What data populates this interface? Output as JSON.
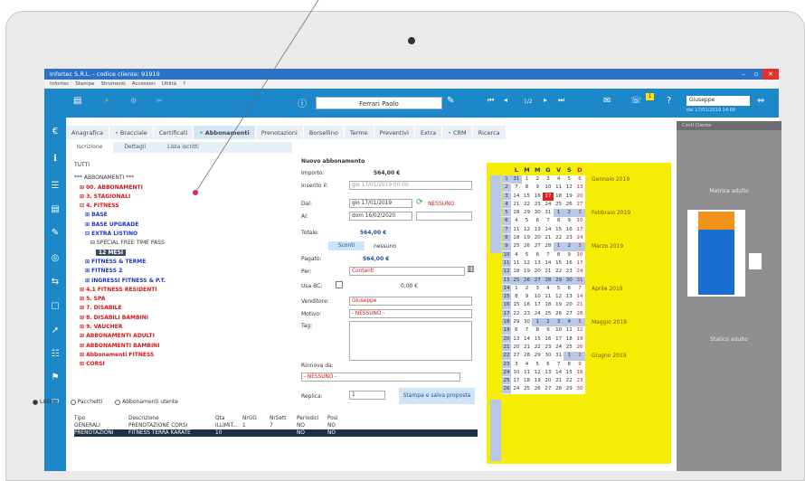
{
  "window": {
    "title": "Infortec S.R.L. - codice cliente: 91919",
    "controls": [
      "–",
      "▫",
      "✕"
    ]
  },
  "menu": [
    "Infortec",
    "Stampe",
    "Strumenti",
    "Accessori",
    "Utilità",
    "?"
  ],
  "toolbar": {
    "info_icon": "ⓘ",
    "patient_name": "Ferrari Paolo",
    "pager": "1/2",
    "badge_count": "1",
    "help": "?",
    "operator": "Giuseppe",
    "operator_sub": "dal 17/01/2019 14:00"
  },
  "sidebar_icons": [
    "€",
    "ℹ",
    "☰",
    "▤",
    "✎",
    "◎",
    "⇆",
    "☐",
    "➚",
    "☷",
    "⚑",
    "▭"
  ],
  "tabs": [
    {
      "label": "Anagrafica",
      "dot": false
    },
    {
      "label": "Bracciale",
      "dot": true
    },
    {
      "label": "Certificati",
      "dot": false
    },
    {
      "label": "Abbonamenti",
      "dot": true,
      "active": true
    },
    {
      "label": "Prenotazioni",
      "dot": false
    },
    {
      "label": "Borsellino",
      "dot": false
    },
    {
      "label": "Terme",
      "dot": false
    },
    {
      "label": "Preventivi",
      "dot": false
    },
    {
      "label": "Extra",
      "dot": false
    },
    {
      "label": "CRM",
      "dot": true
    },
    {
      "label": "Ricerca",
      "dot": false
    }
  ],
  "subtabs": [
    "Iscrizione",
    "Dettagli",
    "Lista iscritti"
  ],
  "tree": {
    "header": "TUTTI",
    "items": [
      {
        "text": "*** ABBONAMENTI ***",
        "cls": "dark",
        "indent": 0
      },
      {
        "text": "⊞ 00. ABBONAMENTI",
        "cls": "red",
        "indent": 1
      },
      {
        "text": "⊞ 3. STAGIONALI",
        "cls": "red",
        "indent": 1
      },
      {
        "text": "⊟ 4. FITNESS",
        "cls": "red",
        "indent": 1
      },
      {
        "text": "⊞ BASE",
        "cls": "blue",
        "indent": 2
      },
      {
        "text": "⊞ BASE UPGRADE",
        "cls": "blue",
        "indent": 2
      },
      {
        "text": "⊟ EXTRA LISTINO",
        "cls": "blue",
        "indent": 2
      },
      {
        "text": "⊟ SPECIAL FREE TIME PASS",
        "cls": "dark",
        "indent": 3
      },
      {
        "text": "12 MESI",
        "cls": "sel",
        "indent": 4
      },
      {
        "text": "⊞ FITNESS & TERME",
        "cls": "blue",
        "indent": 2
      },
      {
        "text": "⊞ FITNESS 2",
        "cls": "blue",
        "indent": 2
      },
      {
        "text": "⊞ INGRESSI FITNESS & P.T.",
        "cls": "blue",
        "indent": 2
      },
      {
        "text": "⊞ 4.1 FITNESS RESIDENTI",
        "cls": "red",
        "indent": 1
      },
      {
        "text": "⊞ 5. SPA",
        "cls": "red",
        "indent": 1
      },
      {
        "text": "⊞ 7. DISABILE",
        "cls": "red",
        "indent": 1
      },
      {
        "text": "⊞ 8. DISABILI BAMBINI",
        "cls": "red",
        "indent": 1
      },
      {
        "text": "⊞ 9. VAUCHER",
        "cls": "red",
        "indent": 1
      },
      {
        "text": "⊞ ABBONAMENTI ADULTI",
        "cls": "red",
        "indent": 1
      },
      {
        "text": "⊞ ABBONAMENTI BAMBINI",
        "cls": "red",
        "indent": 1
      },
      {
        "text": "⊞ Abbonamenti FITNESS",
        "cls": "red",
        "indent": 1
      },
      {
        "text": "⊞ CORSI",
        "cls": "red",
        "indent": 1
      }
    ]
  },
  "radios": [
    {
      "label": "Listino",
      "on": true
    },
    {
      "label": "Pacchetti",
      "on": false
    },
    {
      "label": "Abbonamenti utente",
      "on": false
    }
  ],
  "grid": {
    "headers": [
      "Tipo",
      "Descrizione",
      "Qta",
      "NrGG",
      "NrSett",
      "Periodici",
      "Posi"
    ],
    "rows": [
      [
        "GENERALI",
        "PRENOTAZIONE CORSI",
        "ILLIMIT...",
        "1",
        "7",
        "NO",
        "NO"
      ],
      [
        "PRENOTAZIONI",
        "FITNESS TERRA KARATE",
        "10",
        "",
        "",
        "NO",
        "NO"
      ]
    ]
  },
  "form": {
    "title": "Nuovo abbonamento",
    "importo_label": "Importo:",
    "importo": "564,00 €",
    "inizio_label": "Inserito il:",
    "inizio_value": "gio 17/01/2019 00:00",
    "dal_label": "Dal:",
    "dal_value": "gio 17/01/2019",
    "nessuno": "NESSUNO",
    "al_label": "Al:",
    "al_value": "dom 16/02/2020",
    "totale_label": "Totale:",
    "totale": "564,00 €",
    "sconti_btn": "Sconti",
    "sconti_value": "nessuno",
    "pagato_label": "Pagato:",
    "pagato": "564,00 €",
    "per_label": "Per:",
    "per_value": "Contanti",
    "usa_label": "Usa BC:",
    "usa_value": "0,00 €",
    "venditore_label": "Venditore:",
    "venditore": "Giuseppe",
    "motivo_label": "Motivo:",
    "motivo": "- NESSUNO -",
    "tag_label": "Tag:",
    "rinnova_label": "Rinnova da:",
    "rinnova": "- NESSUNO -",
    "replica_label": "Replica:",
    "replica_value": "1",
    "print_btn": "Stampa e salva proposta"
  },
  "calendar": {
    "days": [
      "L",
      "M",
      "M",
      "G",
      "V",
      "S",
      "D"
    ],
    "weeks": [
      "1",
      "2",
      "3",
      "4",
      "5",
      "6",
      "7",
      "8",
      "9",
      "10",
      "11",
      "12",
      "13",
      "14",
      "15",
      "16",
      "17",
      "18",
      "19",
      "20",
      "21",
      "22",
      "23",
      "24",
      "25",
      "26"
    ],
    "rows": [
      [
        "31",
        "1",
        "2",
        "3",
        "4",
        "5",
        "6"
      ],
      [
        "7",
        "8",
        "9",
        "10",
        "11",
        "12",
        "13"
      ],
      [
        "14",
        "15",
        "16",
        "17",
        "18",
        "19",
        "20"
      ],
      [
        "21",
        "22",
        "23",
        "24",
        "25",
        "26",
        "27"
      ],
      [
        "28",
        "29",
        "30",
        "31",
        "1",
        "2",
        "3"
      ],
      [
        "4",
        "5",
        "6",
        "7",
        "8",
        "9",
        "10"
      ],
      [
        "11",
        "12",
        "13",
        "14",
        "15",
        "16",
        "17"
      ],
      [
        "18",
        "19",
        "20",
        "21",
        "22",
        "23",
        "24"
      ],
      [
        "25",
        "26",
        "27",
        "28",
        "1",
        "2",
        "3"
      ],
      [
        "4",
        "5",
        "6",
        "7",
        "8",
        "9",
        "10"
      ],
      [
        "11",
        "12",
        "13",
        "14",
        "15",
        "16",
        "17"
      ],
      [
        "18",
        "19",
        "20",
        "21",
        "22",
        "23",
        "24"
      ],
      [
        "25",
        "26",
        "27",
        "28",
        "29",
        "30",
        "31"
      ],
      [
        "1",
        "2",
        "3",
        "4",
        "5",
        "6",
        "7"
      ],
      [
        "8",
        "9",
        "10",
        "11",
        "12",
        "13",
        "14"
      ],
      [
        "15",
        "16",
        "17",
        "18",
        "19",
        "20",
        "21"
      ],
      [
        "22",
        "23",
        "24",
        "25",
        "26",
        "27",
        "28"
      ],
      [
        "29",
        "30",
        "1",
        "2",
        "3",
        "4",
        "5"
      ],
      [
        "6",
        "7",
        "8",
        "9",
        "10",
        "11",
        "12"
      ],
      [
        "13",
        "14",
        "15",
        "16",
        "17",
        "18",
        "19"
      ],
      [
        "20",
        "21",
        "22",
        "23",
        "24",
        "25",
        "26"
      ],
      [
        "27",
        "28",
        "29",
        "30",
        "31",
        "1",
        "2"
      ],
      [
        "3",
        "4",
        "5",
        "6",
        "7",
        "8",
        "9"
      ],
      [
        "10",
        "11",
        "12",
        "13",
        "14",
        "15",
        "16"
      ],
      [
        "17",
        "18",
        "19",
        "20",
        "21",
        "22",
        "23"
      ],
      [
        "24",
        "25",
        "26",
        "27",
        "28",
        "29",
        "30"
      ]
    ],
    "today": "17",
    "months": [
      {
        "label": "Gennaio 2019",
        "row": 0
      },
      {
        "label": "Febbraio 2019",
        "row": 4
      },
      {
        "label": "Marzo 2019",
        "row": 8
      },
      {
        "label": "Aprile 2019",
        "row": 13
      },
      {
        "label": "Maggio 2019",
        "row": 17
      },
      {
        "label": "Giugno 2019",
        "row": 21
      }
    ],
    "today_color": "#e2221c"
  },
  "right_panel": {
    "top": "Conti Cliente",
    "label1": "Metrica adulto",
    "label2": "Statico adulto"
  },
  "colors": {
    "accent": "#1c87c9",
    "calendar": "#f5ee04",
    "red_text": "#d01818",
    "blue_text": "#1d33c9"
  }
}
